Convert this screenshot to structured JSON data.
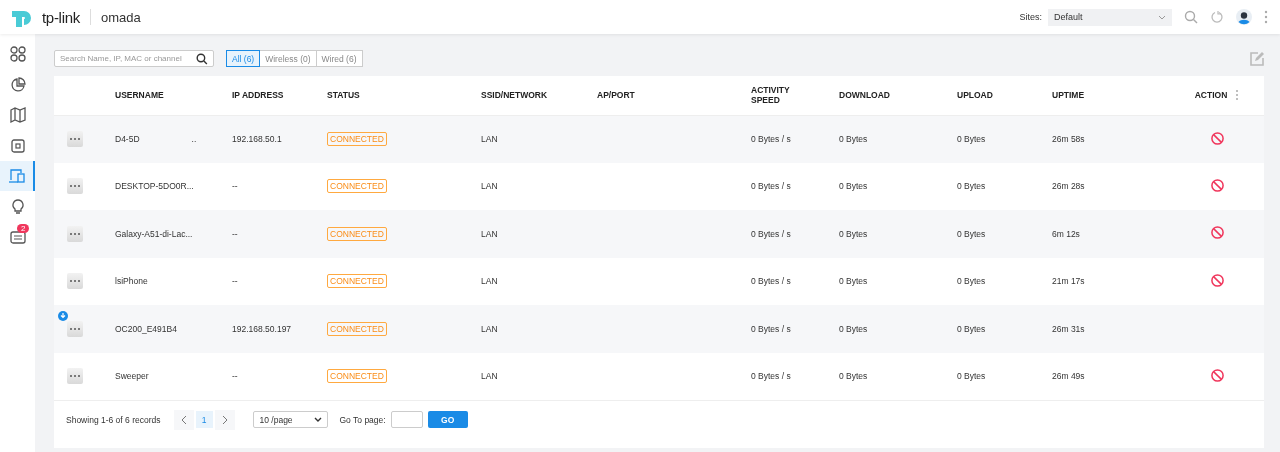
{
  "header": {
    "brand": "tp-link",
    "product": "omada",
    "sites_label": "Sites:",
    "site": "Default"
  },
  "sidebar": {
    "items": [
      {
        "selected": false
      },
      {
        "selected": false
      },
      {
        "selected": false
      },
      {
        "selected": false
      },
      {
        "selected": true
      },
      {
        "selected": false
      },
      {
        "selected": false,
        "badge": "2"
      }
    ]
  },
  "toolbar": {
    "search": {
      "placeholder": "Search Name, IP, MAC or channel"
    },
    "filters": [
      {
        "label": "All (6)",
        "selected": true
      },
      {
        "label": "Wireless (0)",
        "selected": false
      },
      {
        "label": "Wired (6)",
        "selected": false
      }
    ]
  },
  "table": {
    "columns": [
      "USERNAME",
      "IP ADDRESS",
      "STATUS",
      "SSID/NETWORK",
      "AP/PORT",
      "ACTIVITY SPEED",
      "DOWNLOAD",
      "UPLOAD",
      "UPTIME",
      "ACTION"
    ],
    "rows": [
      {
        "username": "D4-5D",
        "username_tail": "..",
        "ip": "192.168.50.1",
        "status": "CONNECTED",
        "network": "LAN",
        "activity": "0 Bytes / s",
        "download": "0 Bytes",
        "upload": "0 Bytes",
        "uptime": "26m 58s",
        "blockable": true,
        "badge": false
      },
      {
        "username": "DESKTOP-5DO0R...",
        "ip": "--",
        "status": "CONNECTED",
        "network": "LAN",
        "activity": "0 Bytes / s",
        "download": "0 Bytes",
        "upload": "0 Bytes",
        "uptime": "26m 28s",
        "blockable": true,
        "badge": false
      },
      {
        "username": "Galaxy-A51-di-Lac...",
        "ip": "--",
        "status": "CONNECTED",
        "network": "LAN",
        "activity": "0 Bytes / s",
        "download": "0 Bytes",
        "upload": "0 Bytes",
        "uptime": "6m 12s",
        "blockable": true,
        "badge": false
      },
      {
        "username": "lsiPhone",
        "ip": "--",
        "status": "CONNECTED",
        "network": "LAN",
        "activity": "0 Bytes / s",
        "download": "0 Bytes",
        "upload": "0 Bytes",
        "uptime": "21m 17s",
        "blockable": true,
        "badge": false
      },
      {
        "username": "OC200_E491B4",
        "ip": "192.168.50.197",
        "status": "CONNECTED",
        "network": "LAN",
        "activity": "0 Bytes / s",
        "download": "0 Bytes",
        "upload": "0 Bytes",
        "uptime": "26m 31s",
        "blockable": false,
        "badge": true
      },
      {
        "username": "Sweeper",
        "ip": "--",
        "status": "CONNECTED",
        "network": "LAN",
        "activity": "0 Bytes / s",
        "download": "0 Bytes",
        "upload": "0 Bytes",
        "uptime": "26m 49s",
        "blockable": true,
        "badge": false
      }
    ]
  },
  "pagination": {
    "summary": "Showing 1-6 of 6 records",
    "pages": [
      {
        "label": "1",
        "selected": true
      }
    ],
    "page_size": "10 /page",
    "goto_label": "Go To page:",
    "go_button": "GO"
  }
}
